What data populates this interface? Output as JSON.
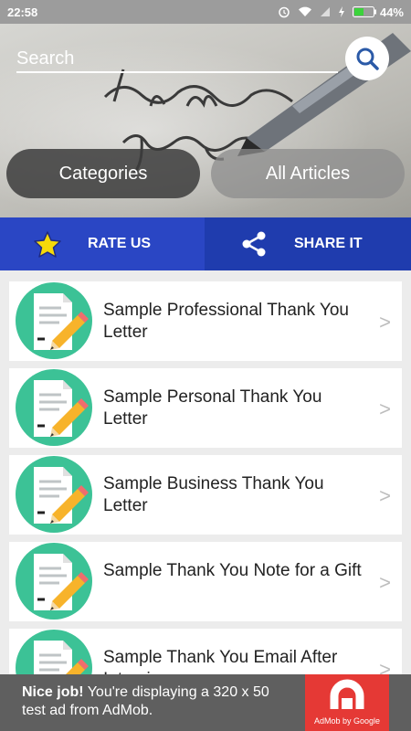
{
  "status_bar": {
    "time": "22:58",
    "battery": "44%"
  },
  "search": {
    "placeholder": "Search"
  },
  "header": {
    "categories_label": "Categories",
    "all_articles_label": "All Articles"
  },
  "actions": {
    "rate_label": "RATE US",
    "share_label": "SHARE IT"
  },
  "articles": [
    {
      "title": "Sample Professional Thank You Letter"
    },
    {
      "title": "Sample Personal Thank You Letter"
    },
    {
      "title": "Sample Business Thank You Letter"
    },
    {
      "title": "Sample Thank You Note for a Gift"
    },
    {
      "title": "Sample Thank You Email After Interview"
    }
  ],
  "list_chevron": ">",
  "ad": {
    "lead": "Nice job!",
    "body": " You're displaying a 320 x 50 test ad from AdMob.",
    "brand": "AdMob by Google"
  },
  "colors": {
    "action_bar": "#2a46c4",
    "thumb_circle": "#3cc296",
    "ad_bg": "#5f5f5f",
    "ad_logo": "#e53935"
  }
}
